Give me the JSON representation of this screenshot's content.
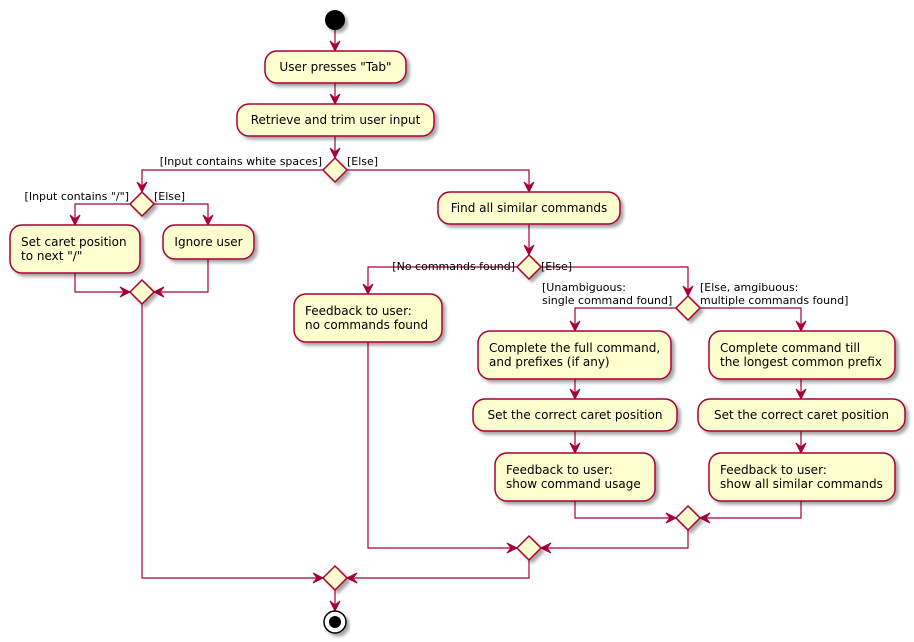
{
  "colors": {
    "border": "#A80036",
    "fill": "#FEFECE",
    "start": "#000000"
  },
  "nodes": {
    "user_presses_tab": [
      "User presses \"Tab\""
    ],
    "retrieve_trim": [
      "Retrieve and trim user input"
    ],
    "set_caret_next_slash": [
      "Set caret position",
      "to next \"/\""
    ],
    "ignore_user": [
      "Ignore user"
    ],
    "find_similar": [
      "Find all similar commands"
    ],
    "feedback_no_commands": [
      "Feedback to user:",
      "no commands found"
    ],
    "complete_full": [
      "Complete the full command,",
      "and prefixes (if any)"
    ],
    "complete_till_prefix": [
      "Complete command till",
      "the longest common prefix"
    ],
    "set_caret_correct_1": [
      "Set the correct caret position"
    ],
    "set_caret_correct_2": [
      "Set the correct caret position"
    ],
    "feedback_usage": [
      "Feedback to user:",
      "show command usage"
    ],
    "feedback_all_similar": [
      "Feedback to user:",
      "show all similar commands"
    ]
  },
  "guards": {
    "white_spaces": "[Input contains white spaces]",
    "white_spaces_else": "[Else]",
    "contains_slash": "[Input contains \"/\"]",
    "contains_slash_else": "[Else]",
    "no_commands": "[No commands found]",
    "no_commands_else": "[Else]",
    "unambiguous": [
      "[Unambiguous:",
      "single command found]"
    ],
    "ambiguous": [
      "[Else, amgibuous:",
      "multiple commands found]"
    ]
  }
}
